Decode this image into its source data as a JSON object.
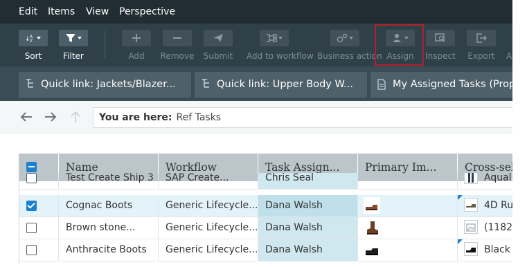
{
  "menu": {
    "items": [
      "Edit",
      "Items",
      "View",
      "Perspective"
    ]
  },
  "toolbar": {
    "buttons": [
      {
        "label": "Sort",
        "icon": "sort-icon",
        "state": "enabled"
      },
      {
        "label": "Filter",
        "icon": "filter-icon",
        "state": "enabled"
      },
      {
        "label": "Add",
        "icon": "plus-icon",
        "state": "disabled"
      },
      {
        "label": "Remove",
        "icon": "minus-icon",
        "state": "disabled"
      },
      {
        "label": "Submit",
        "icon": "send-icon",
        "state": "disabled"
      },
      {
        "label": "Add to workflow",
        "icon": "workflow-icon",
        "state": "disabled"
      },
      {
        "label": "Business action",
        "icon": "business-action-icon",
        "state": "disabled"
      },
      {
        "label": "Assign",
        "icon": "assign-icon",
        "state": "disabled"
      },
      {
        "label": "Inspect",
        "icon": "inspect-icon",
        "state": "disabled"
      },
      {
        "label": "Export",
        "icon": "export-icon",
        "state": "disabled"
      }
    ],
    "overflow_label": "A"
  },
  "tabs": [
    {
      "label": "Quick link: Jackets/Blazer...",
      "icon": "quick-link-icon"
    },
    {
      "label": "Quick link: Upper Body W...",
      "icon": "quick-link-icon"
    },
    {
      "label": "My Assigned Tasks (Prop...",
      "icon": "document-icon"
    }
  ],
  "breadcrumb": {
    "label": "You are here:",
    "value": "Ref Tasks"
  },
  "grid": {
    "columns": [
      "Name",
      "Workflow",
      "Task Assign...",
      "Primary Im...",
      "Cross-sell"
    ],
    "rows": [
      {
        "checked": false,
        "name": "Test Create Ship 3",
        "workflow": "SAP Create...",
        "assignee": "Chris Seal",
        "image": "",
        "cross_sell": "Aqual"
      },
      {
        "checked": true,
        "name": "Cognac Boots",
        "workflow": "Generic Lifecycle...",
        "assignee": "Dana Walsh",
        "image": "cognac-boot-thumbnail",
        "cross_sell": "4D Ru"
      },
      {
        "checked": false,
        "name": "Brown stone...",
        "workflow": "Generic Lifecycle...",
        "assignee": "Dana Walsh",
        "image": "brown-boot-thumbnail",
        "cross_sell": "(1182"
      },
      {
        "checked": false,
        "name": "Anthracite Boots",
        "workflow": "Generic Lifecycle...",
        "assignee": "Dana Walsh",
        "image": "black-boot-thumbnail",
        "cross_sell": "Black"
      }
    ]
  },
  "colors": {
    "menu_bg": "#222c33",
    "toolbar_bg": "#2f4049",
    "tabbar_bg": "#3a4c56",
    "accent": "#1c80d0",
    "highlight_border": "#b3202a",
    "selected_row": "#e4f2fa",
    "task_column": "#cfe7ee"
  }
}
